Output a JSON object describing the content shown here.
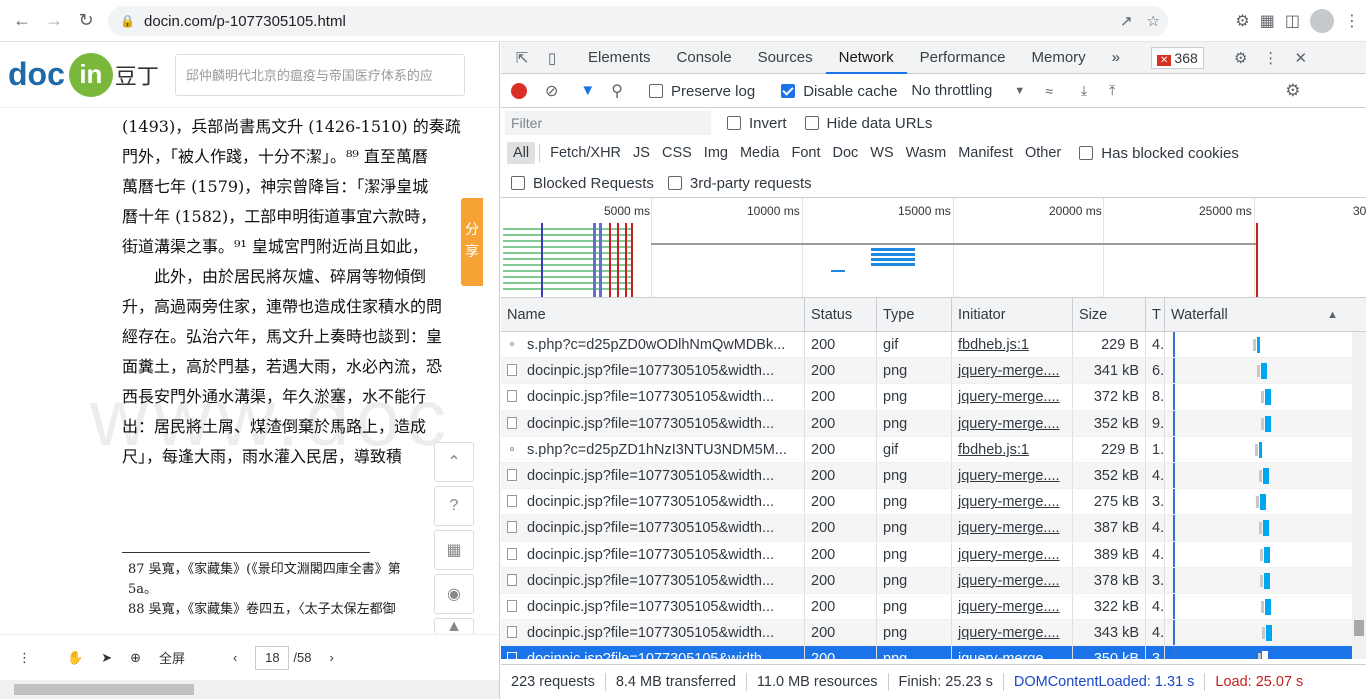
{
  "browser": {
    "url": "docin.com/p-1077305105.html"
  },
  "doc": {
    "logo_doc": "doc",
    "logo_in": "in",
    "logo_cn": "豆丁",
    "search_placeholder": "邱仲麟明代北京的瘟疫与帝国医疗体系的应",
    "lines": [
      "(1493)，兵部尚書馬文升 (1426-1510) 的奏疏",
      "門外，「被人作踐，十分不潔」。⁸⁹ 直至萬曆",
      "萬曆七年 (1579)，神宗曾降旨：「潔淨皇城",
      "曆十年 (1582)，工部申明街道事宜六款時，",
      "街道溝渠之事。⁹¹ 皇城宮門附近尚且如此，",
      "此外，由於居民將灰爐、碎屑等物傾倒",
      "升，高過兩旁住家，連帶也造成住家積水的問",
      "經存在。弘治六年，馬文升上奏時也談到：皇",
      "面糞土，高於門基，若遇大雨，水必內流，恐",
      "西長安門外通水溝渠，年久淤塞，水不能行",
      "出：居民將土屑、煤渣倒棄於馬路上，造成",
      "尺」，每逢大雨，雨水灌入民居，導致積"
    ],
    "watermark": "www.doc",
    "footnotes": [
      "87  吳寬，《家藏集》(《景印文淵閣四庫全書》第",
      "5a。",
      "88  吳寬，《家藏集》卷四五，〈太子太保左都御"
    ],
    "share_label": "分享",
    "bottom": {
      "fullscreen": "全屏",
      "page_current": "18",
      "page_total": "/58"
    }
  },
  "devtools": {
    "tabs": [
      "Elements",
      "Console",
      "Sources",
      "Network",
      "Performance",
      "Memory"
    ],
    "active_tab": "Network",
    "more_tabs": "»",
    "error_count": "368",
    "preserve_log": "Preserve log",
    "disable_cache": "Disable cache",
    "throttling": "No throttling",
    "filter_placeholder": "Filter",
    "invert": "Invert",
    "hide_data_urls": "Hide data URLs",
    "types": [
      "All",
      "Fetch/XHR",
      "JS",
      "CSS",
      "Img",
      "Media",
      "Font",
      "Doc",
      "WS",
      "Wasm",
      "Manifest",
      "Other"
    ],
    "has_blocked_cookies": "Has blocked cookies",
    "blocked_requests": "Blocked Requests",
    "third_party": "3rd-party requests",
    "timeline_ticks": [
      "5000 ms",
      "10000 ms",
      "15000 ms",
      "20000 ms",
      "25000 ms",
      "30"
    ],
    "columns": {
      "name": "Name",
      "status": "Status",
      "type": "Type",
      "initiator": "Initiator",
      "size": "Size",
      "time": "T",
      "waterfall": "Waterfall"
    },
    "rows": [
      {
        "name": "s.php?c=d25pZD0wODlhNmQwMDBk...",
        "status": "200",
        "type": "gif",
        "initiator": "fbdheb.js:1",
        "size": "229 B",
        "time": "4.",
        "icon": "dot"
      },
      {
        "name": "docinpic.jsp?file=1077305105&width...",
        "status": "200",
        "type": "png",
        "initiator": "jquery-merge....",
        "size": "341 kB",
        "time": "6.",
        "icon": "file"
      },
      {
        "name": "docinpic.jsp?file=1077305105&width...",
        "status": "200",
        "type": "png",
        "initiator": "jquery-merge....",
        "size": "372 kB",
        "time": "8.",
        "icon": "file"
      },
      {
        "name": "docinpic.jsp?file=1077305105&width...",
        "status": "200",
        "type": "png",
        "initiator": "jquery-merge....",
        "size": "352 kB",
        "time": "9.",
        "icon": "file"
      },
      {
        "name": "s.php?c=d25pZD1hNzI3NTU3NDM5M...",
        "status": "200",
        "type": "gif",
        "initiator": "fbdheb.js:1",
        "size": "229 B",
        "time": "1.",
        "icon": "dot"
      },
      {
        "name": "docinpic.jsp?file=1077305105&width...",
        "status": "200",
        "type": "png",
        "initiator": "jquery-merge....",
        "size": "352 kB",
        "time": "4.",
        "icon": "file"
      },
      {
        "name": "docinpic.jsp?file=1077305105&width...",
        "status": "200",
        "type": "png",
        "initiator": "jquery-merge....",
        "size": "275 kB",
        "time": "3.",
        "icon": "file"
      },
      {
        "name": "docinpic.jsp?file=1077305105&width...",
        "status": "200",
        "type": "png",
        "initiator": "jquery-merge....",
        "size": "387 kB",
        "time": "4.",
        "icon": "file"
      },
      {
        "name": "docinpic.jsp?file=1077305105&width...",
        "status": "200",
        "type": "png",
        "initiator": "jquery-merge....",
        "size": "389 kB",
        "time": "4.",
        "icon": "file"
      },
      {
        "name": "docinpic.jsp?file=1077305105&width...",
        "status": "200",
        "type": "png",
        "initiator": "jquery-merge....",
        "size": "378 kB",
        "time": "3.",
        "icon": "file"
      },
      {
        "name": "docinpic.jsp?file=1077305105&width...",
        "status": "200",
        "type": "png",
        "initiator": "jquery-merge....",
        "size": "322 kB",
        "time": "4.",
        "icon": "file"
      },
      {
        "name": "docinpic.jsp?file=1077305105&width...",
        "status": "200",
        "type": "png",
        "initiator": "jquery-merge....",
        "size": "343 kB",
        "time": "4.",
        "icon": "file"
      },
      {
        "name": "docinpic.jsp?file=1077305105&width...",
        "status": "200",
        "type": "png",
        "initiator": "jquery-merge....",
        "size": "350 kB",
        "time": "3.",
        "icon": "file",
        "selected": true
      }
    ],
    "status_bar": {
      "requests": "223 requests",
      "transferred": "8.4 MB transferred",
      "resources": "11.0 MB resources",
      "finish": "Finish: 25.23 s",
      "dom_loaded": "DOMContentLoaded: 1.31 s",
      "load": "Load: 25.07 s"
    },
    "colors": {
      "accent": "#1a73e8",
      "record": "#d93025",
      "bar": "#00a6f0"
    }
  }
}
